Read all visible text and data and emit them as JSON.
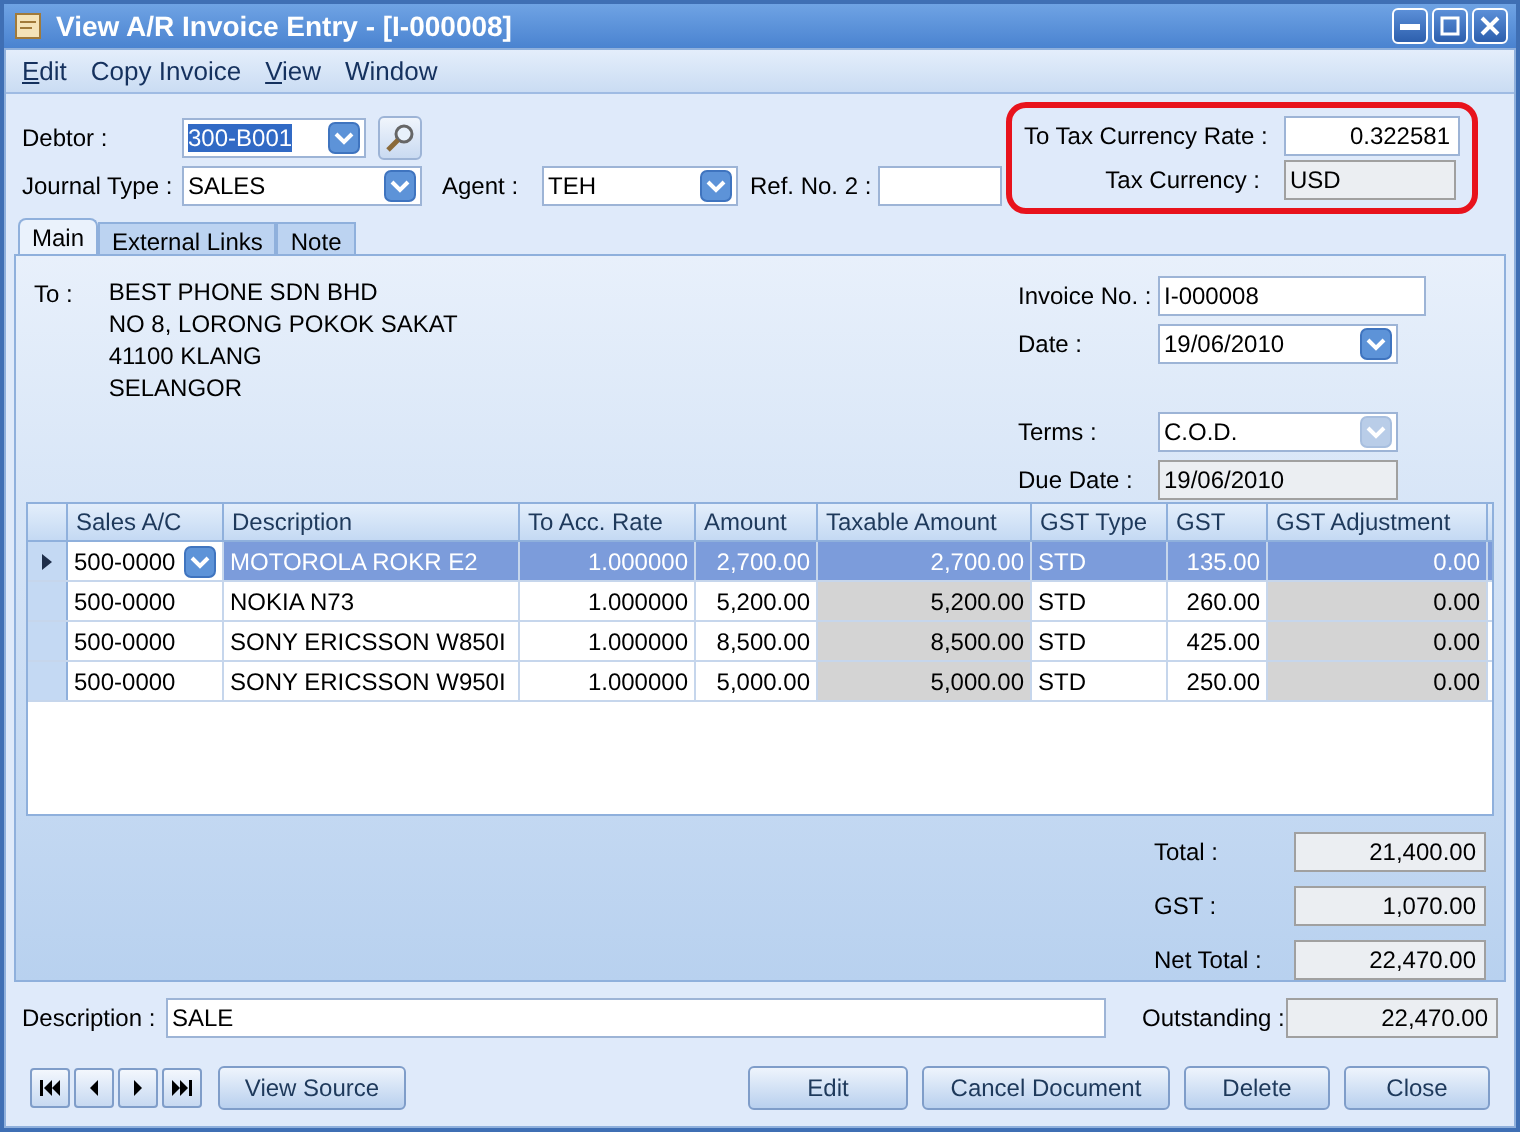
{
  "window": {
    "title": "View A/R Invoice Entry - [I-000008]"
  },
  "menu": [
    {
      "label": "Edit",
      "mnemonic": true
    },
    {
      "label": "Copy Invoice",
      "mnemonic": false
    },
    {
      "label": "View",
      "mnemonic": true
    },
    {
      "label": "Window",
      "mnemonic": false
    }
  ],
  "header": {
    "debtor": {
      "label": "Debtor :",
      "value": "300-B001",
      "text_selected": true
    },
    "journal_type": {
      "label": "Journal Type :",
      "value": "SALES"
    },
    "agent": {
      "label": "Agent :",
      "value": "TEH"
    },
    "ref_no_2": {
      "label": "Ref. No. 2 :"
    },
    "tax_rate": {
      "label": "To Tax Currency Rate :",
      "value": "0.322581"
    },
    "tax_currency": {
      "label": "Tax Currency :",
      "value": "USD"
    }
  },
  "tabs": [
    {
      "label": "Main",
      "selected": true
    },
    {
      "label": "External Links",
      "selected": false
    },
    {
      "label": "Note",
      "selected": false
    }
  ],
  "to": {
    "label": "To :",
    "lines": [
      "BEST PHONE SDN BHD",
      "NO 8, LORONG POKOK SAKAT",
      "41100 KLANG",
      "SELANGOR"
    ]
  },
  "invoice_no": {
    "label": "Invoice No. :",
    "value": "I-000008"
  },
  "date": {
    "label": "Date :",
    "value": "19/06/2010"
  },
  "terms": {
    "label": "Terms :",
    "value": "C.O.D."
  },
  "due_date": {
    "label": "Due Date :",
    "value": "19/06/2010"
  },
  "table": {
    "columns": [
      {
        "label": "Sales A/C",
        "shaded": false
      },
      {
        "label": "Description",
        "shaded": false
      },
      {
        "label": "To Acc. Rate",
        "shaded": false
      },
      {
        "label": "Amount",
        "shaded": false
      },
      {
        "label": "Taxable Amount",
        "shaded": true
      },
      {
        "label": "GST Type",
        "shaded": false
      },
      {
        "label": "GST",
        "shaded": false
      },
      {
        "label": "GST Adjustment",
        "shaded": true
      }
    ],
    "rows": [
      {
        "selected": true,
        "cells": [
          "500-0000",
          "MOTOROLA ROKR E2",
          "1.000000",
          "2,700.00",
          "2,700.00",
          "STD",
          "135.00",
          "0.00"
        ]
      },
      {
        "selected": false,
        "cells": [
          "500-0000",
          "NOKIA N73",
          "1.000000",
          "5,200.00",
          "5,200.00",
          "STD",
          "260.00",
          "0.00"
        ]
      },
      {
        "selected": false,
        "cells": [
          "500-0000",
          "SONY ERICSSON W850I",
          "1.000000",
          "8,500.00",
          "8,500.00",
          "STD",
          "425.00",
          "0.00"
        ]
      },
      {
        "selected": false,
        "cells": [
          "500-0000",
          "SONY ERICSSON W950I",
          "1.000000",
          "5,000.00",
          "5,000.00",
          "STD",
          "250.00",
          "0.00"
        ]
      }
    ]
  },
  "totals": [
    {
      "label": "Total :",
      "value": "21,400.00"
    },
    {
      "label": "GST :",
      "value": "1,070.00"
    },
    {
      "label": "Net Total :",
      "value": "22,470.00"
    }
  ],
  "description": {
    "label": "Description :",
    "value": "SALE"
  },
  "outstanding": {
    "label": "Outstanding :",
    "value": "22,470.00"
  },
  "buttons": [
    {
      "label": "View Source",
      "kind": "left"
    },
    {
      "label": "Edit",
      "kind": "right"
    },
    {
      "label": "Cancel Document",
      "kind": "right"
    },
    {
      "label": "Delete",
      "kind": "right"
    },
    {
      "label": "Close",
      "kind": "right"
    }
  ]
}
